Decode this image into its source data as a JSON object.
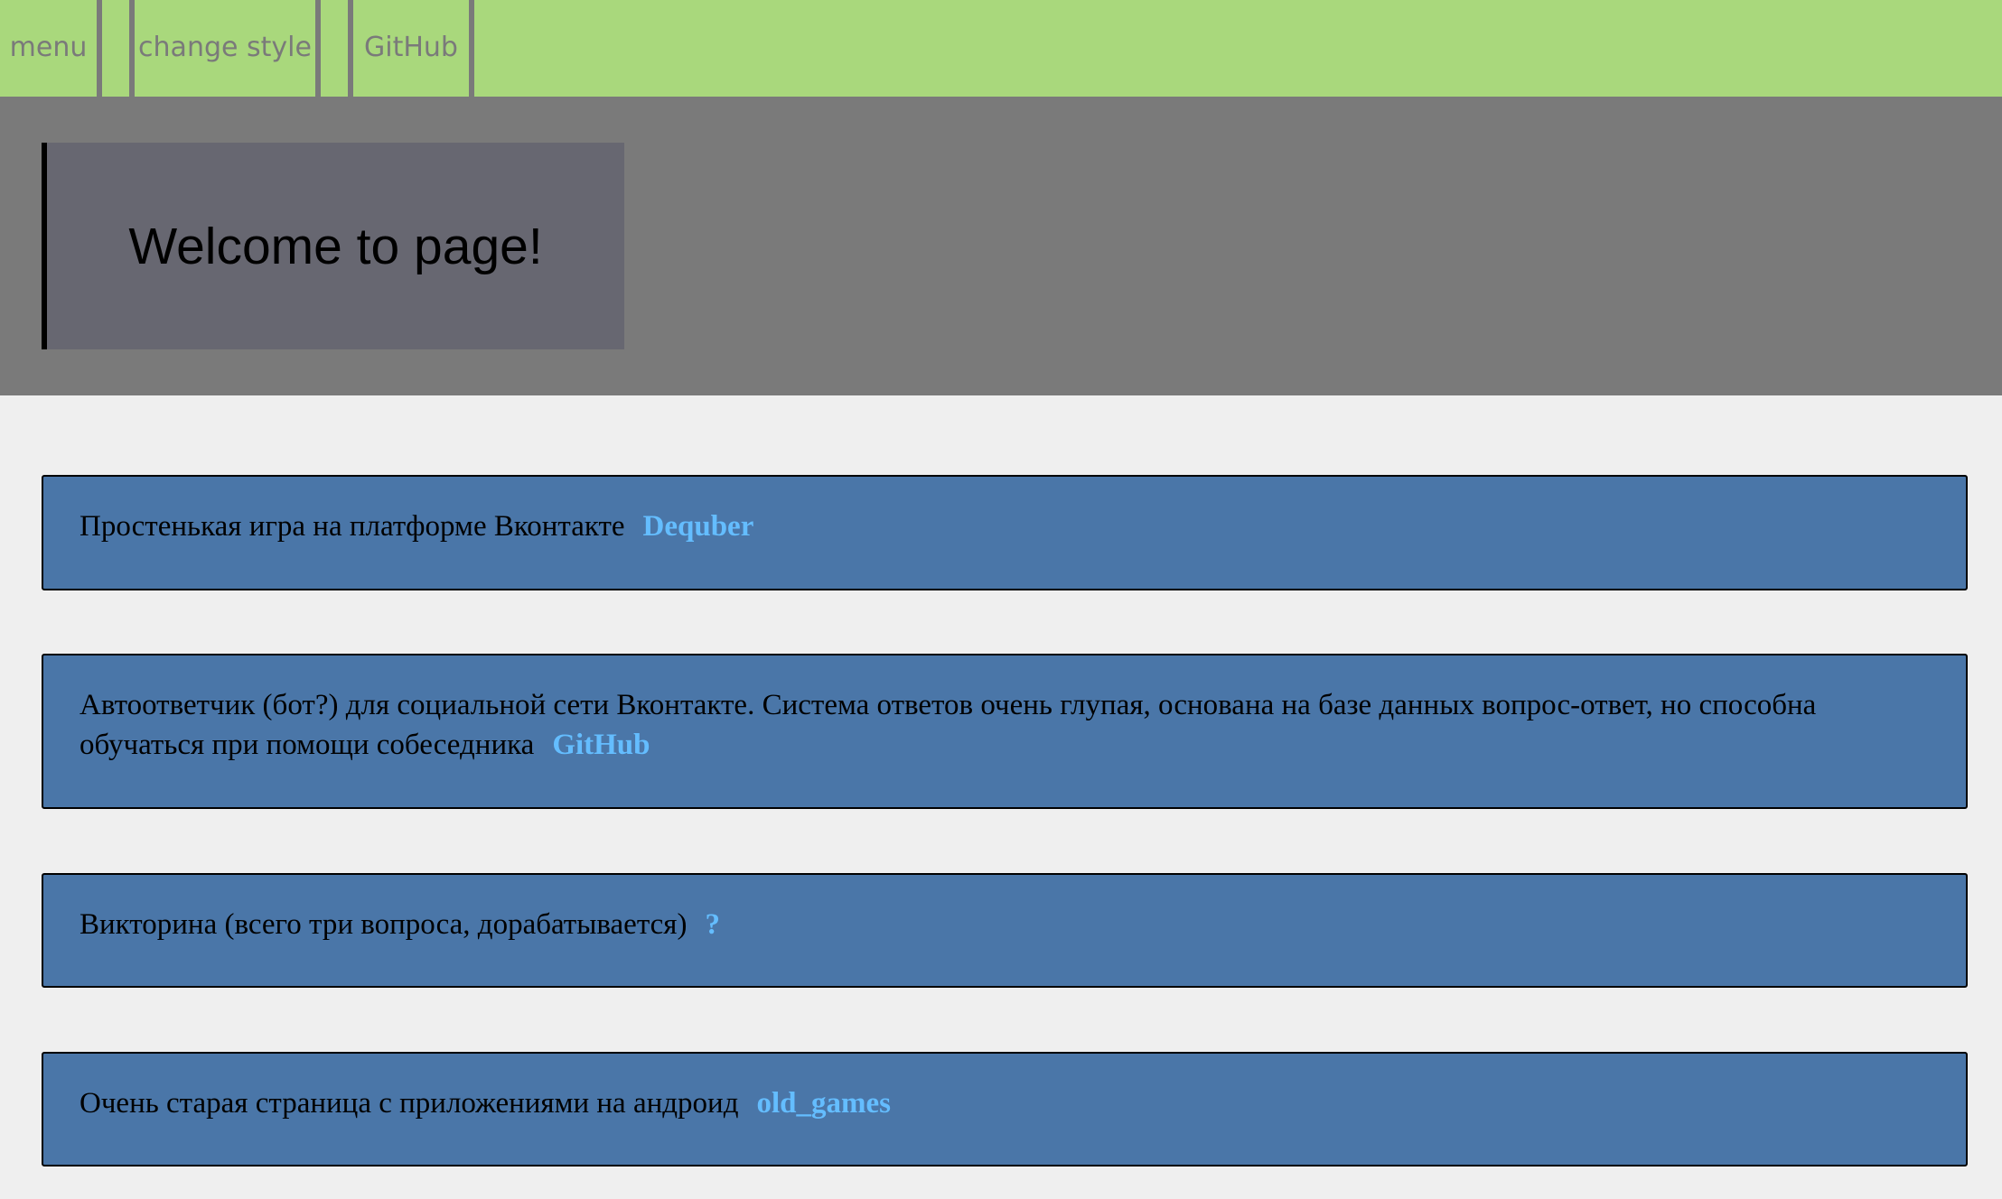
{
  "nav": {
    "items": [
      {
        "label": "menu"
      },
      {
        "label": ""
      },
      {
        "label": "change style"
      },
      {
        "label": ""
      },
      {
        "label": "GitHub"
      }
    ]
  },
  "hero": {
    "title": "Welcome to page!"
  },
  "cards": [
    {
      "text": "Простенькая игра на платформе Вконтакте",
      "link": "Dequber"
    },
    {
      "text": "Автоответчик (бот?) для социальной сети Вконтакте. Система ответов очень глупая, основана на базе данных вопрос-ответ, но способна обучаться при помощи собеседника",
      "link": "GitHub"
    },
    {
      "text": "Викторина (всего три вопроса, дорабатывается)",
      "link": "?"
    },
    {
      "text": "Очень старая страница с приложениями на андроид",
      "link": "old_games"
    }
  ],
  "colors": {
    "topbar": "#a9d87c",
    "nav_text_and_divider": "#7a7a7a",
    "hero_background": "#7a7a7a",
    "welcome_box": "#676771",
    "card_background": "#4a76a8",
    "link": "#64bdff",
    "page_background": "#efefef"
  }
}
